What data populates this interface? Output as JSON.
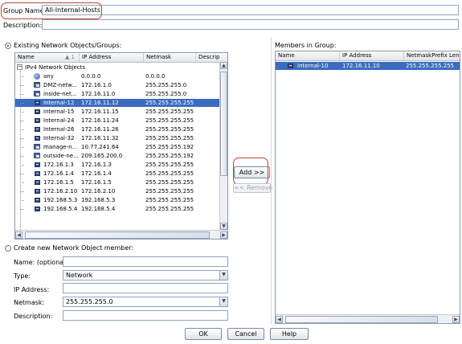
{
  "group_name": {
    "label": "Group Name:",
    "value": "All-Internal-Hosts"
  },
  "description": {
    "label": "Description:",
    "value": ""
  },
  "existing_section": {
    "label": "Existing Network Objects/Groups:"
  },
  "existing_table": {
    "columns": [
      "Name",
      "IP Address",
      "Netmask",
      "Descrip"
    ],
    "sort_indicator": "▲ 1",
    "group_row": "IPv4 Network Objects",
    "rows": [
      {
        "name": "any",
        "ip": "0.0.0.0",
        "mask": "0.0.0.0",
        "icon": "globe-icon"
      },
      {
        "name": "DMZ-netw...",
        "ip": "172.16.1.0",
        "mask": "255.255.255.0",
        "icon": "network-icon"
      },
      {
        "name": "inside-net...",
        "ip": "172.16.11.0",
        "mask": "255.255.255.0",
        "icon": "network-icon"
      },
      {
        "name": "Internal-12",
        "ip": "172.16.11.12",
        "mask": "255.255.255.255",
        "icon": "host-icon",
        "selected": true
      },
      {
        "name": "Internal-15",
        "ip": "172.16.11.15",
        "mask": "255.255.255.255",
        "icon": "host-icon"
      },
      {
        "name": "Internal-24",
        "ip": "172.16.11.24",
        "mask": "255.255.255.255",
        "icon": "host-icon"
      },
      {
        "name": "Internal-26",
        "ip": "172.16.11.26",
        "mask": "255.255.255.255",
        "icon": "host-icon"
      },
      {
        "name": "Internal-32",
        "ip": "172.16.11.32",
        "mask": "255.255.255.255",
        "icon": "host-icon"
      },
      {
        "name": "manage-n...",
        "ip": "10.77.241.64",
        "mask": "255.255.255.192",
        "icon": "network-icon"
      },
      {
        "name": "outside-ne...",
        "ip": "209.165.200.0",
        "mask": "255.255.255.192",
        "icon": "network-icon"
      },
      {
        "name": "172.16.1.3",
        "ip": "172.16.1.3",
        "mask": "255.255.255.255",
        "icon": "host-icon"
      },
      {
        "name": "172.16.1.4",
        "ip": "172.16.1.4",
        "mask": "255.255.255.255",
        "icon": "host-icon"
      },
      {
        "name": "172.16.1.5",
        "ip": "172.16.1.5",
        "mask": "255.255.255.255",
        "icon": "host-icon"
      },
      {
        "name": "172.16.2.10",
        "ip": "172.16.2.10",
        "mask": "255.255.255.255",
        "icon": "host-icon"
      },
      {
        "name": "192.168.5.3",
        "ip": "192.168.5.3",
        "mask": "255.255.255.255",
        "icon": "host-icon"
      },
      {
        "name": "192.168.5.4",
        "ip": "192.168.5.4",
        "mask": "255.255.255.255",
        "icon": "host-icon"
      }
    ]
  },
  "create_section": {
    "label": "Create new Network Object member:"
  },
  "new_member_form": {
    "name_label": "Name: (optional)",
    "name_value": "",
    "type_label": "Type:",
    "type_value": "Network",
    "ip_label": "IP Address:",
    "ip_value": "",
    "netmask_label": "Netmask:",
    "netmask_value": "255.255.255.0",
    "description_label": "Description:",
    "description_value": ""
  },
  "buttons": {
    "add": "Add >>",
    "remove": "<< Remove",
    "ok": "OK",
    "cancel": "Cancel",
    "help": "Help"
  },
  "members_section": {
    "label": "Members in Group:"
  },
  "members_table": {
    "columns": [
      "Name",
      "IP Address",
      "NetmaskPrefix Lengt"
    ],
    "rows": [
      {
        "name": "Internal-10",
        "ip": "172.16.11.10",
        "mask": "255.255.255.255",
        "selected": true
      }
    ]
  },
  "colors": {
    "selection": "#3b6cc0",
    "highlight_ring": "#b9473d"
  }
}
